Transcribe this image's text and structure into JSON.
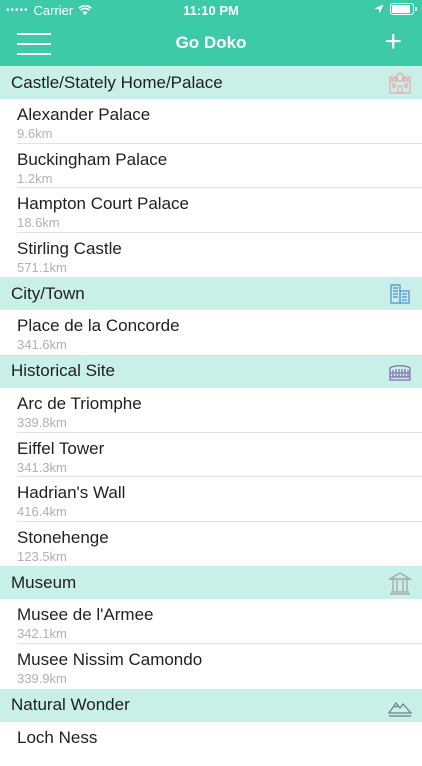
{
  "status": {
    "carrier": "Carrier",
    "time": "11:10 PM",
    "battery_level": 0.9
  },
  "nav": {
    "title": "Go Doko",
    "menu_icon": "hamburger-menu-icon",
    "add_icon": "plus-icon",
    "add_label": "+"
  },
  "colors": {
    "accent": "#3ccaa9",
    "section_bg": "#c8efe8",
    "subtitle": "#b0b0b0"
  },
  "sections": [
    {
      "title": "Castle/Stately Home/Palace",
      "icon": "castle-icon",
      "items": [
        {
          "name": "Alexander Palace",
          "distance": "9.6km"
        },
        {
          "name": "Buckingham Palace",
          "distance": "1.2km"
        },
        {
          "name": "Hampton Court Palace",
          "distance": "18.6km"
        },
        {
          "name": "Stirling Castle",
          "distance": "571.1km"
        }
      ]
    },
    {
      "title": "City/Town",
      "icon": "city-buildings-icon",
      "items": [
        {
          "name": "Place de la Concorde",
          "distance": "341.6km"
        }
      ]
    },
    {
      "title": "Historical Site",
      "icon": "colosseum-icon",
      "items": [
        {
          "name": "Arc de Triomphe",
          "distance": "339.8km"
        },
        {
          "name": "Eiffel Tower",
          "distance": "341.3km"
        },
        {
          "name": "Hadrian's Wall",
          "distance": "416.4km"
        },
        {
          "name": "Stonehenge",
          "distance": "123.5km"
        }
      ]
    },
    {
      "title": "Museum",
      "icon": "museum-icon",
      "items": [
        {
          "name": "Musee de l'Armee",
          "distance": "342.1km"
        },
        {
          "name": "Musee Nissim Camondo",
          "distance": "339.9km"
        }
      ]
    },
    {
      "title": "Natural Wonder",
      "icon": "mountains-icon",
      "items": [
        {
          "name": "Loch Ness",
          "distance": ""
        }
      ]
    }
  ]
}
